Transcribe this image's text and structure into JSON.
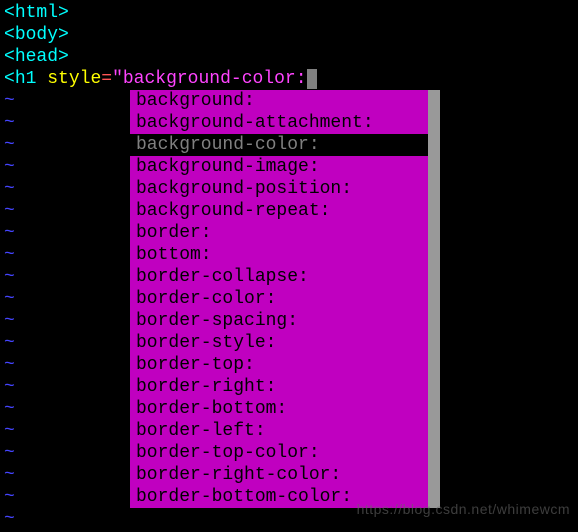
{
  "code": {
    "line1": {
      "bracket_open": "<",
      "tag": "html",
      "bracket_close": ">"
    },
    "line2": {
      "bracket_open": "<",
      "tag": "body",
      "bracket_close": ">"
    },
    "line3": {
      "bracket_open": "<",
      "tag": "head",
      "bracket_close": ">"
    },
    "line4": {
      "bracket_open": "<",
      "tag": "h1",
      "space": " ",
      "attr": "style",
      "eq": "=",
      "quote": "\"",
      "value": "background-color:"
    }
  },
  "tilde": "~",
  "popup": {
    "items": [
      "background:",
      "background-attachment:",
      "background-color:",
      "background-image:",
      "background-position:",
      "background-repeat:",
      "border:",
      "bottom:",
      "border-collapse:",
      "border-color:",
      "border-spacing:",
      "border-style:",
      "border-top:",
      "border-right:",
      "border-bottom:",
      "border-left:",
      "border-top-color:",
      "border-right-color:",
      "border-bottom-color:"
    ],
    "selected_index": 2
  },
  "watermark": "https://blog.csdn.net/whimewcm"
}
